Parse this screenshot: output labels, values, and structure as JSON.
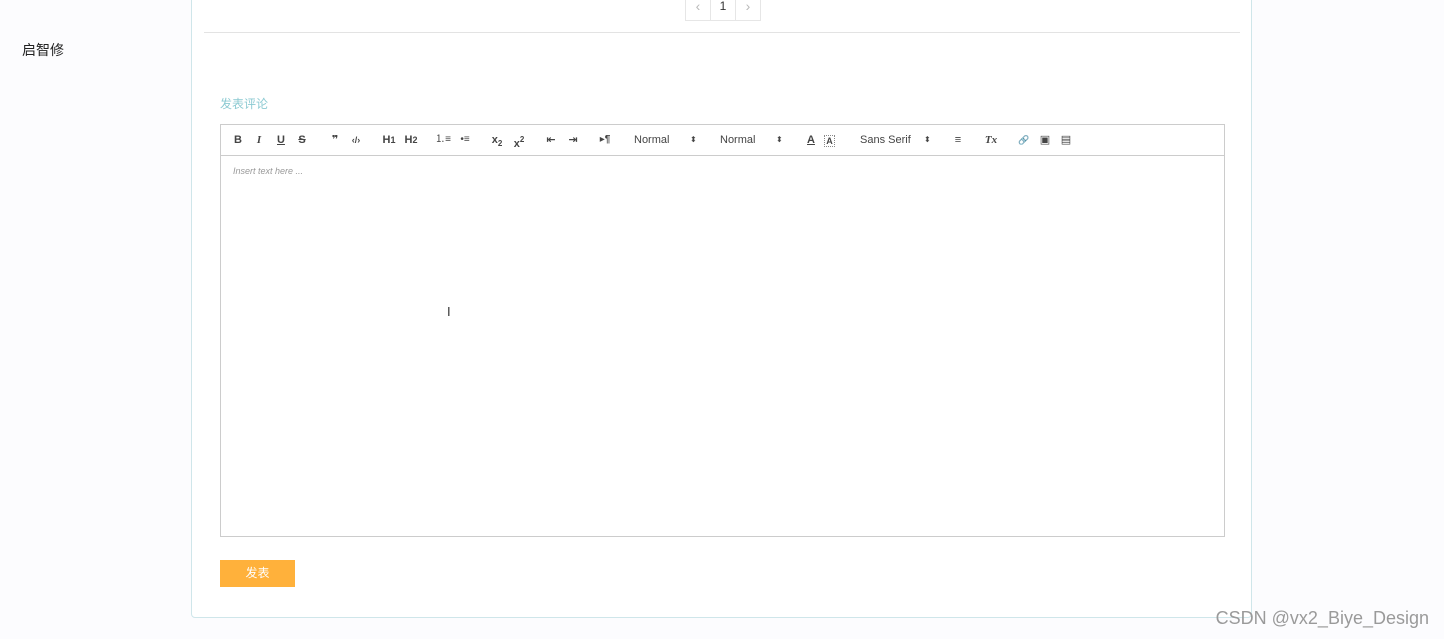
{
  "sidebar": {
    "label": "启智修"
  },
  "pagination": {
    "prev": "‹",
    "current": "1",
    "next": "›"
  },
  "comment": {
    "title": "发表评论"
  },
  "editor": {
    "toolbar": {
      "bold": "B",
      "italic": "I",
      "underline": "U",
      "strike": "S",
      "blockquote": "❞",
      "code": "‹/›",
      "h1": "H",
      "h1_sub": "1",
      "h2": "H",
      "h2_sub": "2",
      "ordered_list": "⒈≡",
      "bullet_list": "•≡",
      "subscript": "x",
      "subscript_mark": "2",
      "superscript": "x",
      "superscript_mark": "2",
      "outdent": "⇤",
      "indent": "⇥",
      "direction": "▸¶",
      "size_select": "Normal",
      "header_select": "Normal",
      "select_arrow": "⬍",
      "text_color": "A",
      "background_color": "A",
      "font_select": "Sans Serif",
      "align": "≡",
      "clean": "Tx",
      "link": "🔗",
      "image": "▣",
      "video": "▤"
    },
    "placeholder": "Insert text here ..."
  },
  "submit": {
    "label": "发表"
  },
  "watermark": "CSDN @vx2_Biye_Design",
  "cursor": "I",
  "colors": {
    "accent": "#8ccad2",
    "button": "#ffb13b",
    "border": "#cfe6ea"
  }
}
